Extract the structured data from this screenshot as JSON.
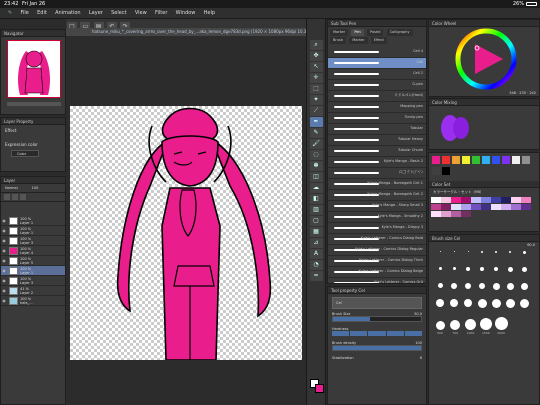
{
  "status": {
    "time": "23:42",
    "date": "Fri Jan 26",
    "battery": "26%"
  },
  "menu": [
    "File",
    "Edit",
    "Animation",
    "Layer",
    "Select",
    "View",
    "Filter",
    "Window",
    "Help"
  ],
  "doc_tab": "hatsune_miku_*_covering_arms_over_the_head_by_...aka_lemon_dge783d.png (1920 × 1080px 96dpi 10.3%)",
  "navigator": {
    "title": "Navigator"
  },
  "layer_property": {
    "title": "Layer Property",
    "effect_label": "Effect",
    "expression_label": "Expression color",
    "expression_value": "Color"
  },
  "layers": {
    "title": "Layer",
    "blend": "Normal",
    "opacity": "100",
    "items": [
      {
        "opacity": "100 %",
        "name": "Layer 1"
      },
      {
        "opacity": "100 %",
        "name": "Layer 1"
      },
      {
        "opacity": "100 %",
        "name": "Layer 3"
      },
      {
        "opacity": "100 %",
        "name": "Layer 4"
      },
      {
        "opacity": "100 %",
        "name": "Layer 5"
      },
      {
        "opacity": "100 %",
        "name": "Layer 1"
      },
      {
        "opacity": "100 %",
        "name": "Layer 3"
      },
      {
        "opacity": "41 %",
        "name": "Layer 2"
      },
      {
        "opacity": "100 %",
        "name": "hats_..."
      }
    ]
  },
  "subtool": {
    "title": "Sub Tool Pen",
    "tabs": [
      "Marker",
      "Pen",
      "Pastel",
      "Calligraphy",
      "Brush",
      "Marker",
      "Effect"
    ],
    "brushes": [
      "Cell 4",
      "Cell",
      "Cell 2",
      "G-pen",
      "ミドルペン(Hard)",
      "Mapping pen",
      "Turnip pen",
      "Tubular",
      "Tubular Heavy",
      "Tubular Chunk",
      "Kyle's Manga - Basic 2",
      "ロゴ ｸﾞﾘｯﾌﾟﾍﾟﾝ",
      "Kyle's Manga - Nomegoth Grit 1",
      "Kyle's Manga - Nomegoth Grit 2",
      "Kyle's Manga - Sharp Small 3",
      "Kyle's Manga - Smoothy 2",
      "Kyle's Manga - Drippy 3",
      "Kyle's Letterer - Comics Dialog Bold",
      "Kyle's Letterer - Comics Dialog Regular",
      "Kyle's Letterer - Comics Dialog Thick",
      "Kyle's Letterer - Comics Dialog Beige",
      "Kyle's Letterer - Comics Grit",
      "Kyle's Letterer - Comics Grunge 1"
    ],
    "selected": 1
  },
  "tool_property": {
    "title": "Tool property Cel",
    "brush_name": "Cel",
    "brush_size_label": "Brush Size",
    "brush_size": "50.0",
    "brush_size_level": 0.42,
    "hardness_label": "Hardness",
    "brush_density_label": "Brush density",
    "brush_density": "100",
    "stabilization_label": "Stabilization",
    "stabilization": "6"
  },
  "color_wheel": {
    "title": "Color Wheel",
    "hsv": "346 · 235 · 242"
  },
  "color_mixing": {
    "title": "Color Mixing"
  },
  "color_set": {
    "title": "Color Set",
    "set_name": "カラーサークル・セット（HB）"
  },
  "brush_size_panel": {
    "title": "Brush size Cel",
    "value": "60.0",
    "labels": [
      "500",
      "700",
      "1000",
      "1500",
      "2000"
    ]
  },
  "colors": {
    "accent": "#e91e8c",
    "selection": "#6f8ec6"
  }
}
